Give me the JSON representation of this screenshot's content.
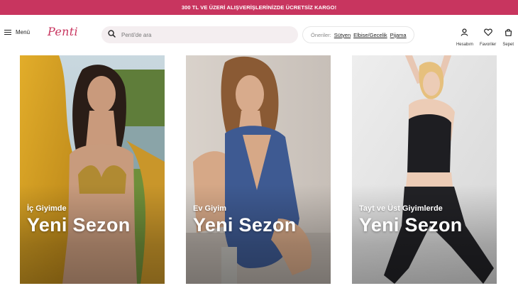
{
  "promo": {
    "text": "300 TL VE ÜZERİ ALIŞVERİŞLERİNİZDE ÜCRETSİZ KARGO!"
  },
  "header": {
    "menu_label": "Menü",
    "logo_text": "Penti",
    "search_placeholder": "Penti'de ara",
    "suggestions_label": "Öneriler:",
    "suggestions": [
      "Sütyen",
      "Elbise/Gecelik",
      "Pijama"
    ],
    "icons": [
      {
        "label": "Hesabım",
        "icon": "user-icon"
      },
      {
        "label": "Favoriler",
        "icon": "heart-icon"
      },
      {
        "label": "Sepet",
        "icon": "bag-icon"
      }
    ]
  },
  "cards": [
    {
      "subtitle": "İç Giyimde",
      "title": "Yeni Sezon"
    },
    {
      "subtitle": "Ev Giyim",
      "title": "Yeni Sezon"
    },
    {
      "subtitle": "Tayt ve Üst Giyimlerde",
      "title": "Yeni Sezon"
    }
  ],
  "colors": {
    "brand": "#c8355f",
    "search_bg": "#f4eef0"
  }
}
